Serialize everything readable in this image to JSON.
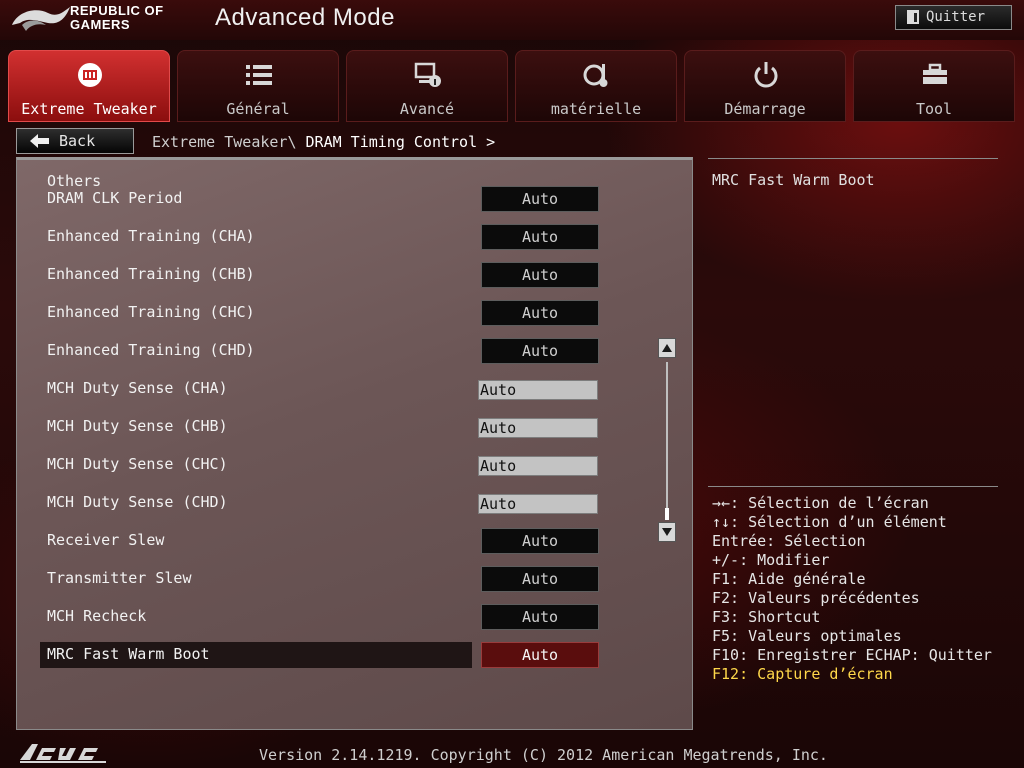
{
  "header": {
    "brand_line1": "REPUBLIC OF",
    "brand_line2": "GAMERS",
    "mode_title": "Advanced Mode",
    "quit_label": "Quitter"
  },
  "tabs": [
    {
      "label": "Extreme Tweaker",
      "icon": "tweaker-icon",
      "active": true
    },
    {
      "label": "Général",
      "icon": "list-icon",
      "active": false
    },
    {
      "label": "Avancé",
      "icon": "advanced-icon",
      "active": false
    },
    {
      "label": "matérielle",
      "icon": "monitor-icon",
      "active": false
    },
    {
      "label": "Démarrage",
      "icon": "power-icon",
      "active": false
    },
    {
      "label": "Tool",
      "icon": "toolbox-icon",
      "active": false
    }
  ],
  "nav": {
    "back_label": "Back",
    "breadcrumb_parent": "Extreme Tweaker\\",
    "breadcrumb_current": "DRAM Timing Control >"
  },
  "main": {
    "section_label": "Others",
    "rows": [
      {
        "label": "DRAM CLK Period",
        "value": "Auto",
        "kind": "select"
      },
      {
        "label": "Enhanced Training (CHA)",
        "value": "Auto",
        "kind": "select"
      },
      {
        "label": "Enhanced Training (CHB)",
        "value": "Auto",
        "kind": "select"
      },
      {
        "label": "Enhanced Training (CHC)",
        "value": "Auto",
        "kind": "select"
      },
      {
        "label": "Enhanced Training (CHD)",
        "value": "Auto",
        "kind": "select"
      },
      {
        "label": "MCH Duty Sense (CHA)",
        "value": "Auto",
        "kind": "input"
      },
      {
        "label": "MCH Duty Sense (CHB)",
        "value": "Auto",
        "kind": "input"
      },
      {
        "label": "MCH Duty Sense (CHC)",
        "value": "Auto",
        "kind": "input"
      },
      {
        "label": "MCH Duty Sense (CHD)",
        "value": "Auto",
        "kind": "input"
      },
      {
        "label": "Receiver Slew",
        "value": "Auto",
        "kind": "select"
      },
      {
        "label": "Transmitter Slew",
        "value": "Auto",
        "kind": "select"
      },
      {
        "label": "MCH Recheck",
        "value": "Auto",
        "kind": "select"
      },
      {
        "label": "MRC Fast Warm Boot",
        "value": "Auto",
        "kind": "select",
        "selected": true
      }
    ]
  },
  "help": {
    "title": "MRC Fast Warm Boot",
    "keys": [
      "→←: Sélection de l’écran",
      "↑↓: Sélection d’un élément",
      "Entrée: Sélection",
      "+/-: Modifier",
      "F1: Aide générale",
      "F2: Valeurs précédentes",
      "F3: Shortcut",
      "F5: Valeurs optimales",
      "F10: Enregistrer  ECHAP: Quitter"
    ],
    "highlight_key": "F12: Capture d’écran"
  },
  "footer": {
    "version_text": "Version 2.14.1219. Copyright (C) 2012 American Megatrends, Inc."
  },
  "colors": {
    "accent_red": "#c42222",
    "selected_value_bg": "#5a0d0d",
    "highlight_yellow": "#ffd84a",
    "panel_bg": "#7a6464"
  }
}
